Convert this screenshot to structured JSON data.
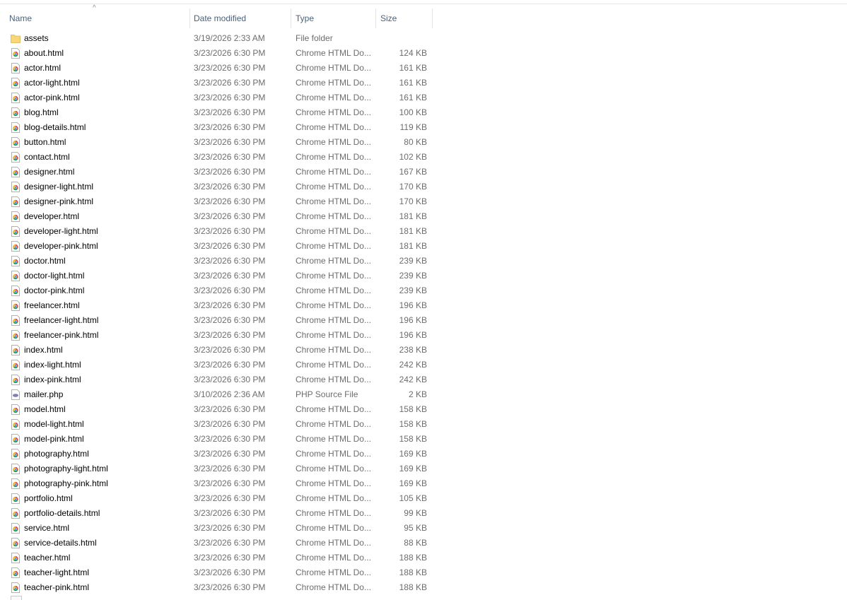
{
  "columns": {
    "name": "Name",
    "date": "Date modified",
    "type": "Type",
    "size": "Size"
  },
  "sort_indicator": "^",
  "files": [
    {
      "name": "assets",
      "date": "3/19/2026 2:33 AM",
      "type": "File folder",
      "size": "",
      "icon": "folder-icon"
    },
    {
      "name": "about.html",
      "date": "3/23/2026 6:30 PM",
      "type": "Chrome HTML Do...",
      "size": "124 KB",
      "icon": "chrome-html-icon"
    },
    {
      "name": "actor.html",
      "date": "3/23/2026 6:30 PM",
      "type": "Chrome HTML Do...",
      "size": "161 KB",
      "icon": "chrome-html-icon"
    },
    {
      "name": "actor-light.html",
      "date": "3/23/2026 6:30 PM",
      "type": "Chrome HTML Do...",
      "size": "161 KB",
      "icon": "chrome-html-icon"
    },
    {
      "name": "actor-pink.html",
      "date": "3/23/2026 6:30 PM",
      "type": "Chrome HTML Do...",
      "size": "161 KB",
      "icon": "chrome-html-icon"
    },
    {
      "name": "blog.html",
      "date": "3/23/2026 6:30 PM",
      "type": "Chrome HTML Do...",
      "size": "100 KB",
      "icon": "chrome-html-icon"
    },
    {
      "name": "blog-details.html",
      "date": "3/23/2026 6:30 PM",
      "type": "Chrome HTML Do...",
      "size": "119 KB",
      "icon": "chrome-html-icon"
    },
    {
      "name": "button.html",
      "date": "3/23/2026 6:30 PM",
      "type": "Chrome HTML Do...",
      "size": "80 KB",
      "icon": "chrome-html-icon"
    },
    {
      "name": "contact.html",
      "date": "3/23/2026 6:30 PM",
      "type": "Chrome HTML Do...",
      "size": "102 KB",
      "icon": "chrome-html-icon"
    },
    {
      "name": "designer.html",
      "date": "3/23/2026 6:30 PM",
      "type": "Chrome HTML Do...",
      "size": "167 KB",
      "icon": "chrome-html-icon"
    },
    {
      "name": "designer-light.html",
      "date": "3/23/2026 6:30 PM",
      "type": "Chrome HTML Do...",
      "size": "170 KB",
      "icon": "chrome-html-icon"
    },
    {
      "name": "designer-pink.html",
      "date": "3/23/2026 6:30 PM",
      "type": "Chrome HTML Do...",
      "size": "170 KB",
      "icon": "chrome-html-icon"
    },
    {
      "name": "developer.html",
      "date": "3/23/2026 6:30 PM",
      "type": "Chrome HTML Do...",
      "size": "181 KB",
      "icon": "chrome-html-icon"
    },
    {
      "name": "developer-light.html",
      "date": "3/23/2026 6:30 PM",
      "type": "Chrome HTML Do...",
      "size": "181 KB",
      "icon": "chrome-html-icon"
    },
    {
      "name": "developer-pink.html",
      "date": "3/23/2026 6:30 PM",
      "type": "Chrome HTML Do...",
      "size": "181 KB",
      "icon": "chrome-html-icon"
    },
    {
      "name": "doctor.html",
      "date": "3/23/2026 6:30 PM",
      "type": "Chrome HTML Do...",
      "size": "239 KB",
      "icon": "chrome-html-icon"
    },
    {
      "name": "doctor-light.html",
      "date": "3/23/2026 6:30 PM",
      "type": "Chrome HTML Do...",
      "size": "239 KB",
      "icon": "chrome-html-icon"
    },
    {
      "name": "doctor-pink.html",
      "date": "3/23/2026 6:30 PM",
      "type": "Chrome HTML Do...",
      "size": "239 KB",
      "icon": "chrome-html-icon"
    },
    {
      "name": "freelancer.html",
      "date": "3/23/2026 6:30 PM",
      "type": "Chrome HTML Do...",
      "size": "196 KB",
      "icon": "chrome-html-icon"
    },
    {
      "name": "freelancer-light.html",
      "date": "3/23/2026 6:30 PM",
      "type": "Chrome HTML Do...",
      "size": "196 KB",
      "icon": "chrome-html-icon"
    },
    {
      "name": "freelancer-pink.html",
      "date": "3/23/2026 6:30 PM",
      "type": "Chrome HTML Do...",
      "size": "196 KB",
      "icon": "chrome-html-icon"
    },
    {
      "name": "index.html",
      "date": "3/23/2026 6:30 PM",
      "type": "Chrome HTML Do...",
      "size": "238 KB",
      "icon": "chrome-html-icon"
    },
    {
      "name": "index-light.html",
      "date": "3/23/2026 6:30 PM",
      "type": "Chrome HTML Do...",
      "size": "242 KB",
      "icon": "chrome-html-icon"
    },
    {
      "name": "index-pink.html",
      "date": "3/23/2026 6:30 PM",
      "type": "Chrome HTML Do...",
      "size": "242 KB",
      "icon": "chrome-html-icon"
    },
    {
      "name": "mailer.php",
      "date": "3/10/2026 2:36 AM",
      "type": "PHP Source File",
      "size": "2 KB",
      "icon": "php-file-icon"
    },
    {
      "name": "model.html",
      "date": "3/23/2026 6:30 PM",
      "type": "Chrome HTML Do...",
      "size": "158 KB",
      "icon": "chrome-html-icon"
    },
    {
      "name": "model-light.html",
      "date": "3/23/2026 6:30 PM",
      "type": "Chrome HTML Do...",
      "size": "158 KB",
      "icon": "chrome-html-icon"
    },
    {
      "name": "model-pink.html",
      "date": "3/23/2026 6:30 PM",
      "type": "Chrome HTML Do...",
      "size": "158 KB",
      "icon": "chrome-html-icon"
    },
    {
      "name": "photography.html",
      "date": "3/23/2026 6:30 PM",
      "type": "Chrome HTML Do...",
      "size": "169 KB",
      "icon": "chrome-html-icon"
    },
    {
      "name": "photography-light.html",
      "date": "3/23/2026 6:30 PM",
      "type": "Chrome HTML Do...",
      "size": "169 KB",
      "icon": "chrome-html-icon"
    },
    {
      "name": "photography-pink.html",
      "date": "3/23/2026 6:30 PM",
      "type": "Chrome HTML Do...",
      "size": "169 KB",
      "icon": "chrome-html-icon"
    },
    {
      "name": "portfolio.html",
      "date": "3/23/2026 6:30 PM",
      "type": "Chrome HTML Do...",
      "size": "105 KB",
      "icon": "chrome-html-icon"
    },
    {
      "name": "portfolio-details.html",
      "date": "3/23/2026 6:30 PM",
      "type": "Chrome HTML Do...",
      "size": "99 KB",
      "icon": "chrome-html-icon"
    },
    {
      "name": "service.html",
      "date": "3/23/2026 6:30 PM",
      "type": "Chrome HTML Do...",
      "size": "95 KB",
      "icon": "chrome-html-icon"
    },
    {
      "name": "service-details.html",
      "date": "3/23/2026 6:30 PM",
      "type": "Chrome HTML Do...",
      "size": "88 KB",
      "icon": "chrome-html-icon"
    },
    {
      "name": "teacher.html",
      "date": "3/23/2026 6:30 PM",
      "type": "Chrome HTML Do...",
      "size": "188 KB",
      "icon": "chrome-html-icon"
    },
    {
      "name": "teacher-light.html",
      "date": "3/23/2026 6:30 PM",
      "type": "Chrome HTML Do...",
      "size": "188 KB",
      "icon": "chrome-html-icon"
    },
    {
      "name": "teacher-pink.html",
      "date": "3/23/2026 6:30 PM",
      "type": "Chrome HTML Do...",
      "size": "188 KB",
      "icon": "chrome-html-icon"
    }
  ],
  "colors": {
    "header_text": "#4c607a",
    "secondary_text": "#6d6d6d",
    "folder_yellow": "#f8d775",
    "chrome_red": "#db4437",
    "chrome_yellow": "#f4b400",
    "chrome_green": "#0f9d58",
    "chrome_blue": "#4285f4",
    "php_purple": "#7b7fb5"
  }
}
